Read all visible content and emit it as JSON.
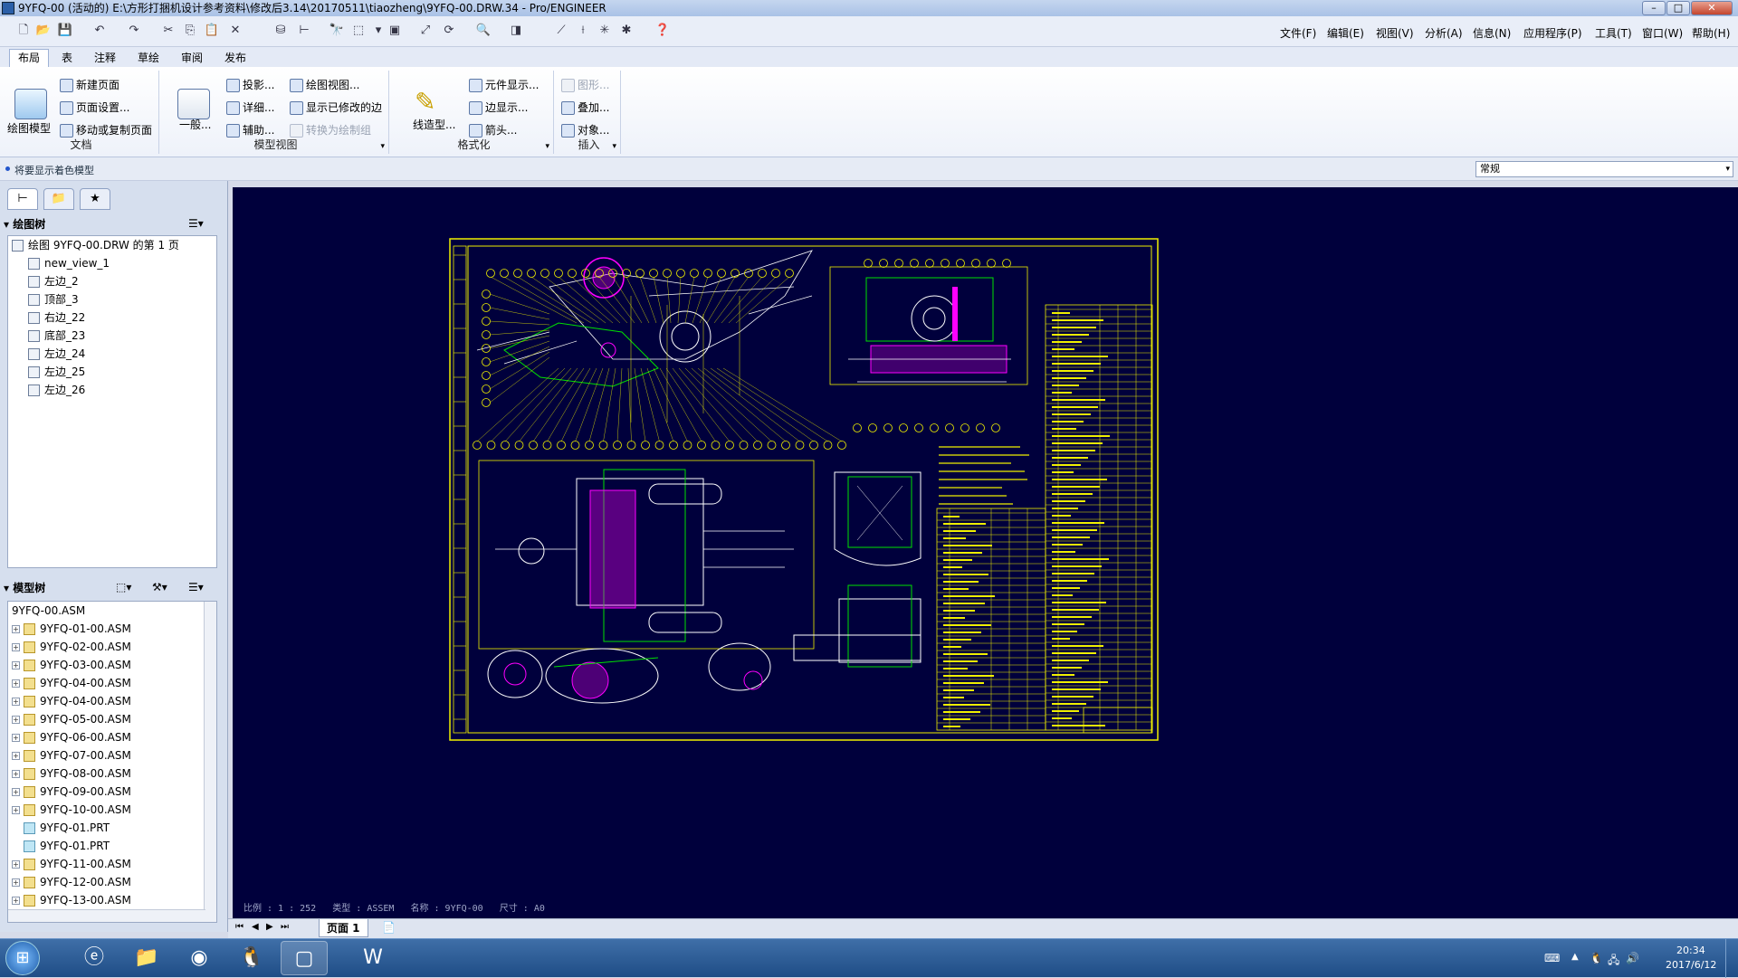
{
  "window": {
    "title": "9YFQ-00 (活动的) E:\\方形打捆机设计参考资料\\修改后3.14\\20170511\\tiaozheng\\9YFQ-00.DRW.34 - Pro/ENGINEER"
  },
  "menubar": [
    "文件(F)",
    "编辑(E)",
    "视图(V)",
    "分析(A)",
    "信息(N)",
    "应用程序(P)",
    "工具(T)",
    "窗口(W)",
    "帮助(H)"
  ],
  "tabs": [
    "布局",
    "表",
    "注释",
    "草绘",
    "审阅",
    "发布"
  ],
  "ribbon": {
    "doc": {
      "label": "文档",
      "big": "绘图模型",
      "items": [
        "新建页面",
        "页面设置...",
        "移动或复制页面"
      ]
    },
    "model_views": {
      "label": "模型视图",
      "big": "一般...",
      "col1": [
        "投影...",
        "详细...",
        "辅助..."
      ],
      "col2": [
        "绘图视图...",
        "显示已修改的边",
        "转换为绘制组"
      ]
    },
    "format": {
      "label": "格式化",
      "big": "线造型...",
      "items": [
        "元件显示...",
        "边显示...",
        "箭头..."
      ]
    },
    "insert": {
      "label": "插入",
      "items": [
        "图形...",
        "叠加...",
        "对象..."
      ]
    }
  },
  "message": "将要显示着色模型",
  "style_select": "常规",
  "drawing_tree": {
    "title": "绘图树",
    "root": "绘图 9YFQ-00.DRW 的第 1 页",
    "items": [
      "new_view_1",
      "左边_2",
      "顶部_3",
      "右边_22",
      "底部_23",
      "左边_24",
      "左边_25",
      "左边_26"
    ]
  },
  "model_tree": {
    "title": "模型树",
    "root": "9YFQ-00.ASM",
    "items": [
      {
        "name": "9YFQ-01-00.ASM",
        "type": "asm"
      },
      {
        "name": "9YFQ-02-00.ASM",
        "type": "asm"
      },
      {
        "name": "9YFQ-03-00.ASM",
        "type": "asm"
      },
      {
        "name": "9YFQ-04-00.ASM",
        "type": "asm"
      },
      {
        "name": "9YFQ-04-00.ASM",
        "type": "asm"
      },
      {
        "name": "9YFQ-05-00.ASM",
        "type": "asm"
      },
      {
        "name": "9YFQ-06-00.ASM",
        "type": "asm"
      },
      {
        "name": "9YFQ-07-00.ASM",
        "type": "asm"
      },
      {
        "name": "9YFQ-08-00.ASM",
        "type": "asm"
      },
      {
        "name": "9YFQ-09-00.ASM",
        "type": "asm"
      },
      {
        "name": "9YFQ-10-00.ASM",
        "type": "asm"
      },
      {
        "name": "9YFQ-01.PRT",
        "type": "prt"
      },
      {
        "name": "9YFQ-01.PRT",
        "type": "prt"
      },
      {
        "name": "9YFQ-11-00.ASM",
        "type": "asm"
      },
      {
        "name": "9YFQ-12-00.ASM",
        "type": "asm"
      },
      {
        "name": "9YFQ-13-00.ASM",
        "type": "asm"
      }
    ]
  },
  "canvas_status": "比例 : 1 : 252   类型 : ASSEM   名称 : 9YFQ-00   尺寸 : A0",
  "sheet_tab": "页面 1",
  "clock": {
    "time": "20:34",
    "date": "2017/6/12"
  },
  "colors": {
    "canvas": "#00003c",
    "frame": "#f0f000",
    "green": "#00e000",
    "magenta": "#ff00ff",
    "white": "#ffffff"
  }
}
